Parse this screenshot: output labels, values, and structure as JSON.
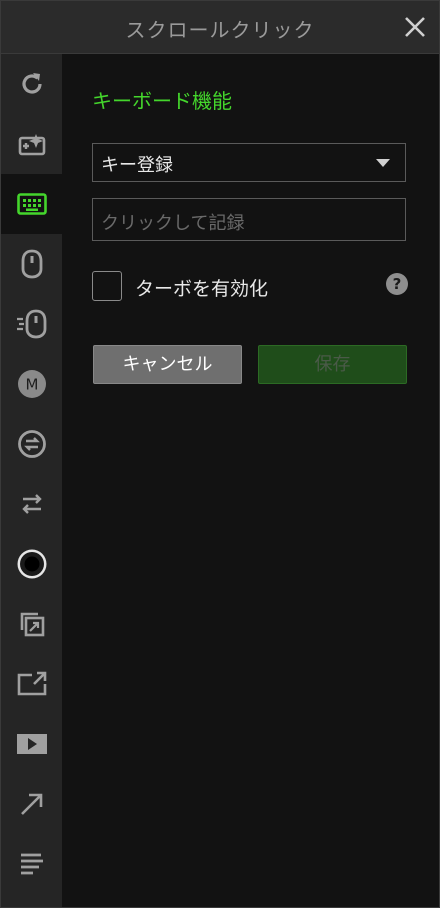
{
  "window": {
    "title": "スクロールクリック"
  },
  "sidebar": {
    "items": [
      {
        "icon": "refresh-icon"
      },
      {
        "icon": "magic-plus-icon"
      },
      {
        "icon": "keyboard-icon",
        "active": true
      },
      {
        "icon": "mouse-icon"
      },
      {
        "icon": "mouse-speed-icon"
      },
      {
        "icon": "macro-m-icon"
      },
      {
        "icon": "swap-circle-icon"
      },
      {
        "icon": "switch-arrows-icon"
      },
      {
        "icon": "record-circle-icon"
      },
      {
        "icon": "open-window-icon"
      },
      {
        "icon": "launch-icon"
      },
      {
        "icon": "media-play-icon"
      },
      {
        "icon": "diagonal-arrow-icon"
      },
      {
        "icon": "text-lines-icon"
      }
    ]
  },
  "main": {
    "section_title": "キーボード機能",
    "key_select": {
      "value": "キー登録"
    },
    "record_input": {
      "placeholder": "クリックして記録"
    },
    "turbo": {
      "label": "ターボを有効化",
      "checked": false,
      "help": "?"
    },
    "buttons": {
      "cancel": "キャンセル",
      "save": "保存"
    }
  },
  "colors": {
    "accent": "#44d62c",
    "save_bg": "#1f4d1a",
    "cancel_bg": "#6f6f6f"
  }
}
